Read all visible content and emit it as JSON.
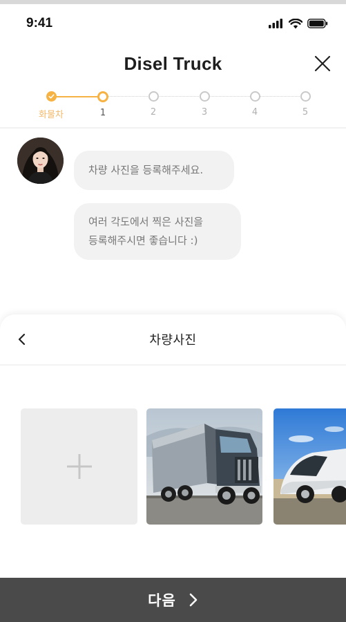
{
  "status_bar": {
    "time": "9:41",
    "icons": [
      "signal-icon",
      "wifi-icon",
      "battery-icon"
    ]
  },
  "header": {
    "title": "Disel Truck",
    "close_icon": "close-icon"
  },
  "stepper": {
    "steps": [
      {
        "label": "화물차",
        "state": "done"
      },
      {
        "label": "1",
        "state": "current"
      },
      {
        "label": "2",
        "state": "todo"
      },
      {
        "label": "3",
        "state": "todo"
      },
      {
        "label": "4",
        "state": "todo"
      },
      {
        "label": "5",
        "state": "todo"
      }
    ]
  },
  "chat": {
    "messages": [
      {
        "line1": "차량 사진을 등록해주세요."
      },
      {
        "line1": "여러 각도에서 찍은 사진을",
        "line2": "등록해주시면 좋습니다 :)"
      }
    ]
  },
  "sheet": {
    "title": "차량사진",
    "back_icon": "chevron-left-icon",
    "add_icon": "plus-icon"
  },
  "footer": {
    "next_label": "다음",
    "next_icon": "chevron-right-icon"
  },
  "colors": {
    "accent": "#f6b344",
    "footer_bg": "#4a4a4a",
    "bubble_bg": "#f2f2f2"
  }
}
